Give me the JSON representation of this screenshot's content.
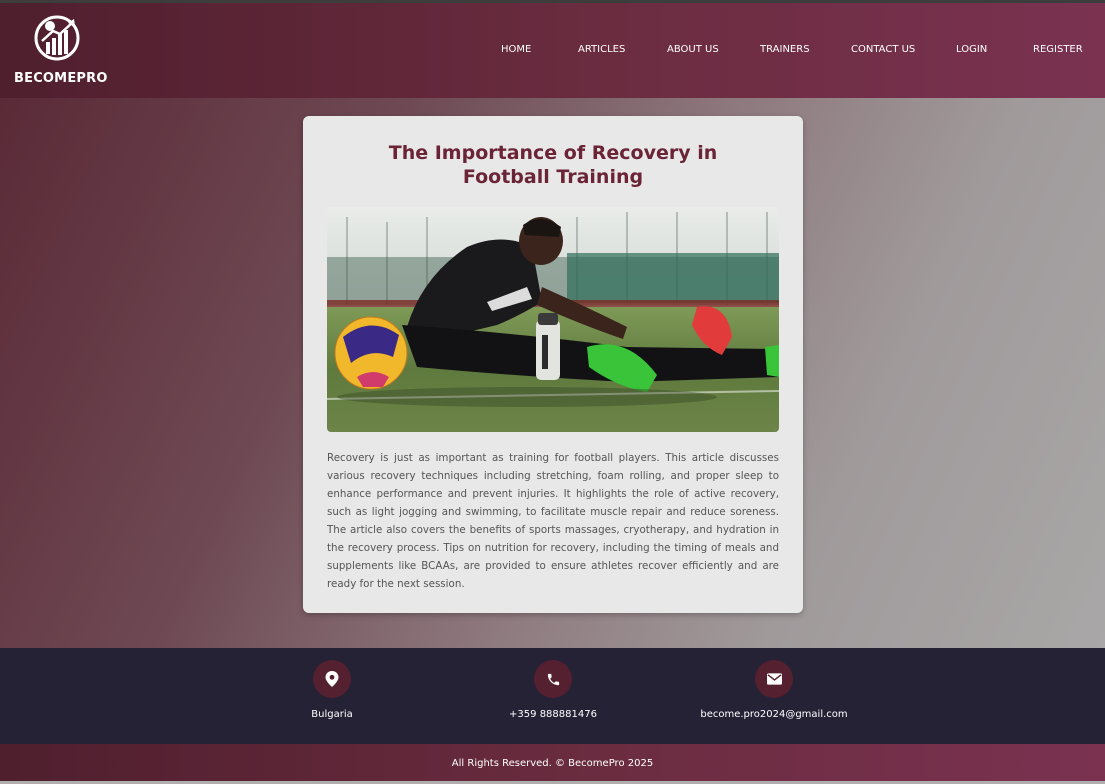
{
  "header": {
    "brand": "BECOMEPRO",
    "nav": [
      "HOME",
      "ARTICLES",
      "ABOUT US",
      "TRAINERS",
      "CONTACT US",
      "LOGIN",
      "REGISTER"
    ]
  },
  "article": {
    "title": "The Importance of Recovery in Football Training",
    "image_alt": "Football player stretching on the pitch next to a ball and water bottle",
    "body": "Recovery is just as important as training for football players. This article discusses various recovery techniques including stretching, foam rolling, and proper sleep to enhance performance and prevent injuries. It highlights the role of active recovery, such as light jogging and swimming, to facilitate muscle repair and reduce soreness. The article also covers the benefits of sports massages, cryotherapy, and hydration in the recovery process. Tips on nutrition for recovery, including the timing of meals and supplements like BCAAs, are provided to ensure athletes recover efficiently and are ready for the next session."
  },
  "footer": {
    "contacts": [
      {
        "icon": "location-pin-icon",
        "text": "Bulgaria"
      },
      {
        "icon": "phone-icon",
        "text": "+359 888881476"
      },
      {
        "icon": "envelope-icon",
        "text": "become.pro2024@gmail.com"
      }
    ],
    "copyright": "All Rights Reserved. © BecomePro 2025"
  },
  "colors": {
    "header_bg": "#6b2c40",
    "title": "#6a2436",
    "footer_bg": "#252236",
    "icon_circle": "#55202f"
  }
}
